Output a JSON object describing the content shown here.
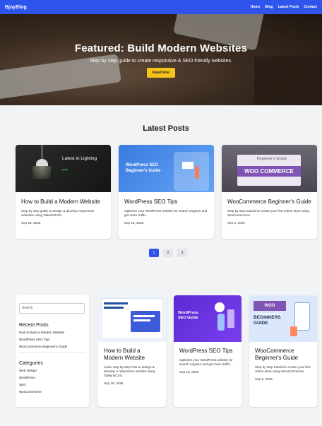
{
  "nav": {
    "brand": "BjoyBlog",
    "links": [
      "Home",
      "Blog",
      "Latest Posts",
      "Contact"
    ]
  },
  "hero": {
    "title": "Featured: Build Modern Websites",
    "subtitle": "Step by step guide to create responsive & SEO friendly websites.",
    "button": "Read Now"
  },
  "latest": {
    "heading": "Latest Posts",
    "posts": [
      {
        "title": "How to Build a Modern Website",
        "desc": "Step by step guide to design & develop responsive websites using TailwindCSS.",
        "date": "Sep 18, 2025",
        "thumb_text": "Latest in Lighting"
      },
      {
        "title": "WordPress SEO Tips",
        "desc": "Optimize your WordPress website for search engines and get more traffic.",
        "date": "Sep 18, 2025",
        "thumb_text": "WordPress SEO Beginner's Guide"
      },
      {
        "title": "WooCommerce Beginner's Guide",
        "desc": "Step by step tutorial to create your first online store using WooCommerce.",
        "date": "Sep 5, 2025",
        "thumb_text": "Beginner's Guide"
      }
    ]
  },
  "pagination": [
    "1",
    "2",
    "3"
  ],
  "sidebar": {
    "search_placeholder": "Search",
    "recent_heading": "Recent Posts",
    "recent": [
      "How to Build a Modern Website",
      "WordPress SEO Tips",
      "WooCommerce Beginner's Guide"
    ],
    "categories_heading": "Categories",
    "categories": [
      "Web Design",
      "WordPress",
      "SEO",
      "WooCommerce"
    ]
  },
  "more_posts": [
    {
      "title": "How to Build a Modern Website",
      "desc": "Learn step by step how to design & develop a responsive website using TailwindCSS.",
      "date": "Sep 18, 2025"
    },
    {
      "title": "WordPress SEO Tips",
      "desc": "Optimize your WordPress website for search engines and get more traffic.",
      "date": "Sep 18, 2025"
    },
    {
      "title": "WooCommerce Beginner's Guide",
      "desc": "Step by step tutorial to create your first online store using WooCommerce.",
      "date": "Sep 5, 2025"
    }
  ],
  "colors": {
    "accent": "#2f54eb",
    "button": "#f6c31a"
  }
}
